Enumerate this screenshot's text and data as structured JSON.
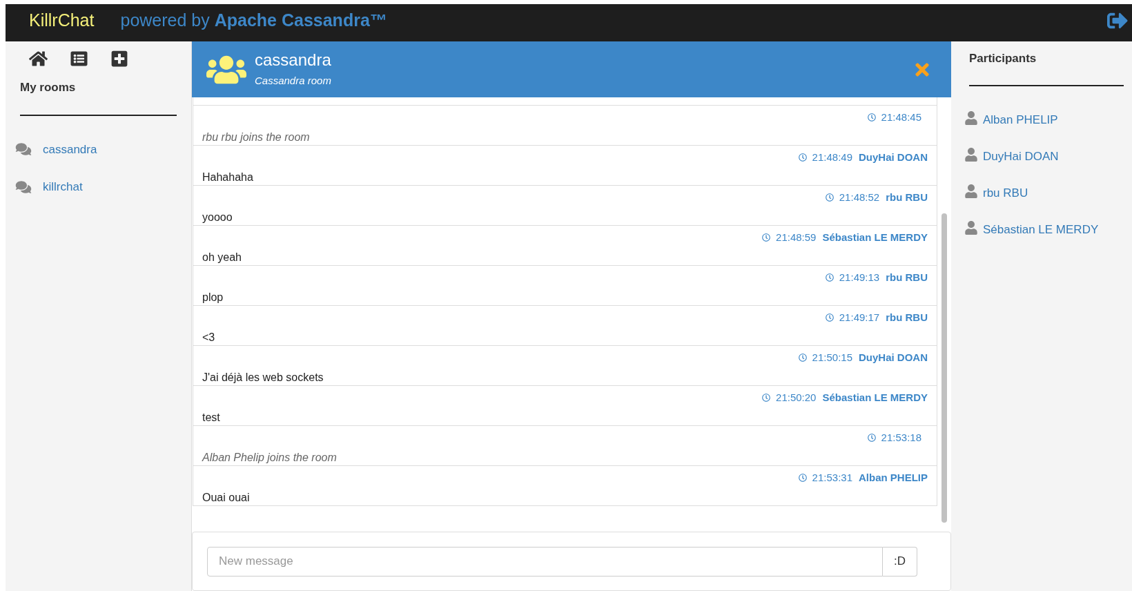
{
  "header": {
    "brand": "KillrChat",
    "tagline_prefix": "powered by",
    "tagline_strong": "Apache Cassandra™"
  },
  "sidebar": {
    "title": "My rooms",
    "rooms": [
      {
        "name": "cassandra"
      },
      {
        "name": "killrchat"
      }
    ]
  },
  "room": {
    "name": "cassandra",
    "description": "Cassandra room"
  },
  "messages": [
    {
      "kind": "system",
      "time": "21:48:45",
      "text": "rbu rbu joins the room"
    },
    {
      "kind": "message",
      "time": "21:48:49",
      "author": "DuyHai DOAN",
      "text": "Hahahaha"
    },
    {
      "kind": "message",
      "time": "21:48:52",
      "author": "rbu RBU",
      "text": "yoooo"
    },
    {
      "kind": "message",
      "time": "21:48:59",
      "author": "Sébastian LE MERDY",
      "text": "oh yeah"
    },
    {
      "kind": "message",
      "time": "21:49:13",
      "author": "rbu RBU",
      "text": "plop"
    },
    {
      "kind": "message",
      "time": "21:49:17",
      "author": "rbu RBU",
      "text": "<3"
    },
    {
      "kind": "message",
      "time": "21:50:15",
      "author": "DuyHai DOAN",
      "text": "J'ai déjà les web sockets"
    },
    {
      "kind": "message",
      "time": "21:50:20",
      "author": "Sébastian LE MERDY",
      "text": "test"
    },
    {
      "kind": "system",
      "time": "21:53:18",
      "text": "Alban Phelip joins the room"
    },
    {
      "kind": "message",
      "time": "21:53:31",
      "author": "Alban PHELIP",
      "text": "Ouai ouai"
    }
  ],
  "composer": {
    "placeholder": "New message",
    "emoji_button": ":D"
  },
  "participants": {
    "title": "Participants",
    "people": [
      {
        "name": "Alban PHELIP"
      },
      {
        "name": "DuyHai DOAN"
      },
      {
        "name": "rbu RBU"
      },
      {
        "name": "Sébastian LE MERDY"
      }
    ]
  }
}
